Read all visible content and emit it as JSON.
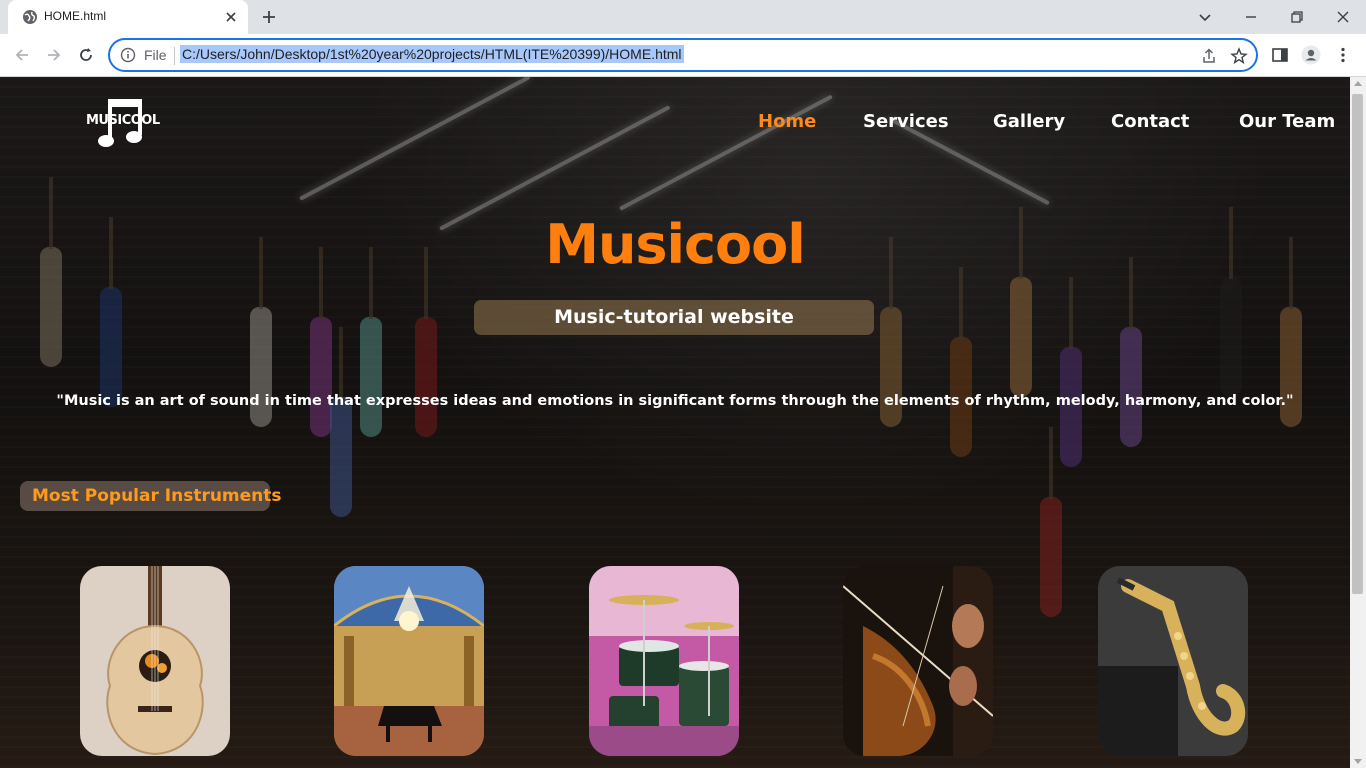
{
  "browser": {
    "tab_title": "HOME.html",
    "file_label": "File",
    "url": "C:/Users/John/Desktop/1st%20year%20projects/HTML(ITE%20399)/HOME.html"
  },
  "site": {
    "logo_text": "MUSICOOL",
    "nav": [
      {
        "label": "Home",
        "active": true
      },
      {
        "label": "Services",
        "active": false
      },
      {
        "label": "Gallery",
        "active": false
      },
      {
        "label": "Contact",
        "active": false
      },
      {
        "label": "Our Team",
        "active": false
      }
    ],
    "title": "Musicool",
    "subtitle": "Music-tutorial website",
    "quote": "\"Music is an art of sound in time that expresses ideas and emotions in significant forms through the elements of rhythm, melody, harmony, and color.\"",
    "section_heading": "Most Popular Instruments",
    "instruments": [
      "guitar",
      "piano",
      "drums",
      "violin",
      "saxophone"
    ]
  },
  "colors": {
    "accent": "#ff7f0e",
    "nav_active": "#ff8a1a",
    "omnibox_border": "#1a73e8",
    "url_highlight": "#a8c7fa"
  }
}
